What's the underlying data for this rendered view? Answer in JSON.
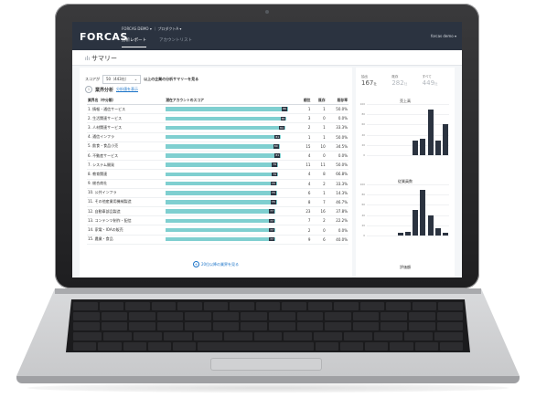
{
  "app": {
    "logo": "FORCAS",
    "breadcrumb": "FORCAS DEMO ▾ ｜ プロダクトA ▾",
    "user": "forcas demo ▾",
    "tabs": [
      {
        "label": "分析レポート",
        "active": true
      },
      {
        "label": "アカウントリスト",
        "active": false
      }
    ],
    "page_title": "サマリー"
  },
  "filter": {
    "prefix": "スコアが",
    "selected": "50（443社）",
    "suffix": "以上の企業の分析サマリーを見る"
  },
  "section": {
    "number": "1",
    "title": "業界分析",
    "link": "分析値を表示"
  },
  "table": {
    "headers": [
      "業界名（中分類）",
      "潜在アカウントのスコア",
      "順位",
      "既存",
      "既存率"
    ],
    "rows": [
      {
        "name": "1. 情報・通信サービス",
        "score": 86,
        "rank": "1",
        "existing": "1",
        "rate": "50.0%"
      },
      {
        "name": "2. 生活関連サービス",
        "score": 85,
        "rank": "3",
        "existing": "0",
        "rate": "0.0%"
      },
      {
        "name": "3. 人材関連サービス",
        "score": 84,
        "rank": "2",
        "existing": "1",
        "rate": "33.3%"
      },
      {
        "name": "4. 通信インフラ",
        "score": 81,
        "rank": "1",
        "existing": "1",
        "rate": "50.0%"
      },
      {
        "name": "5. 飲食・食品小売",
        "score": 80,
        "rank": "15",
        "existing": "10",
        "rate": "34.5%"
      },
      {
        "name": "6. 不動産サービス",
        "score": 81,
        "rank": "4",
        "existing": "0",
        "rate": "0.0%"
      },
      {
        "name": "7. システム開発",
        "score": 79,
        "rank": "11",
        "existing": "11",
        "rate": "50.0%"
      },
      {
        "name": "8. 教育関連",
        "score": 79,
        "rank": "4",
        "existing": "8",
        "rate": "66.8%"
      },
      {
        "name": "9. 総合商社",
        "score": 78,
        "rank": "4",
        "existing": "2",
        "rate": "33.3%"
      },
      {
        "name": "10. 公共インフラ",
        "score": 78,
        "rank": "6",
        "existing": "1",
        "rate": "14.3%"
      },
      {
        "name": "11. その他産業用機械製造",
        "score": 78,
        "rank": "8",
        "existing": "7",
        "rate": "46.7%"
      },
      {
        "name": "12. 自動車部品製造",
        "score": 77,
        "rank": "23",
        "existing": "16",
        "rate": "37.8%"
      },
      {
        "name": "13. コンテンツ制作・配信",
        "score": 77,
        "rank": "7",
        "existing": "2",
        "rate": "22.2%"
      },
      {
        "name": "14. 家電・IOAの販売",
        "score": 77,
        "rank": "2",
        "existing": "0",
        "rate": "0.0%"
      },
      {
        "name": "15. 農業・食品",
        "score": 77,
        "rank": "9",
        "existing": "6",
        "rate": "40.0%"
      }
    ],
    "more_label": "20位以降の業界を見る"
  },
  "stats": [
    {
      "label": "抽出",
      "value": "167",
      "unit": "社",
      "light": false
    },
    {
      "label": "既存",
      "value": "282",
      "unit": "社",
      "light": true
    },
    {
      "label": "すべて",
      "value": "449",
      "unit": "社",
      "light": true
    }
  ],
  "chart_data": [
    {
      "type": "bar",
      "title": "売上高",
      "ylim": [
        0,
        100
      ],
      "yticks": [
        "100",
        "80",
        "60",
        "40",
        "20",
        "0"
      ],
      "values": [
        0,
        0,
        0,
        0,
        0,
        0,
        28,
        32,
        90,
        28,
        60
      ],
      "color": "#2b3340"
    },
    {
      "type": "bar",
      "title": "従業員数",
      "ylim": [
        0,
        100
      ],
      "yticks": [
        "100",
        "80",
        "60",
        "40",
        "20",
        "0"
      ],
      "values": [
        0,
        0,
        0,
        0,
        5,
        8,
        50,
        90,
        40,
        15,
        5
      ],
      "color": "#2b3340"
    },
    {
      "type": "bar",
      "title": "評価額",
      "ylim": [
        0,
        100
      ],
      "yticks": [],
      "values": [],
      "color": "#2b3340"
    }
  ],
  "colors": {
    "accent": "#7fcfd0",
    "header": "#2b3340",
    "link": "#1a73c8"
  }
}
